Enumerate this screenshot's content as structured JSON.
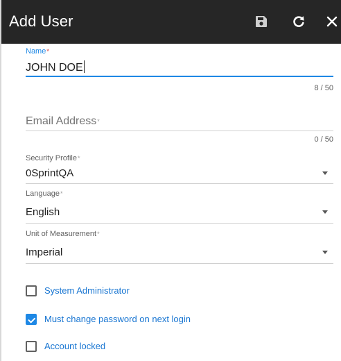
{
  "dialog": {
    "title": "Add User",
    "save_icon": "save-icon",
    "refresh_icon": "refresh-icon",
    "close_icon": "close-icon"
  },
  "form": {
    "name": {
      "label": "Name",
      "required_mark": "*",
      "value": "JOHN DOE",
      "counter": "8 / 50"
    },
    "email": {
      "placeholder": "Email Address",
      "required_mark": "*",
      "value": "",
      "counter": "0 / 50"
    },
    "security_profile": {
      "label": "Security Profile",
      "required_mark": "*",
      "value": "0SprintQA"
    },
    "language": {
      "label": "Language",
      "required_mark": "*",
      "value": "English"
    },
    "unit_of_measurement": {
      "label": "Unit of Measurement",
      "required_mark": "*",
      "value": "Imperial"
    },
    "checkboxes": [
      {
        "label": "System Administrator",
        "checked": false
      },
      {
        "label": "Must change password on next login",
        "checked": true
      },
      {
        "label": "Account locked",
        "checked": false
      }
    ]
  },
  "colors": {
    "header_bg": "#262626",
    "accent": "#1e88e5",
    "link_text": "#1976d2",
    "required": "#d32f2f"
  }
}
